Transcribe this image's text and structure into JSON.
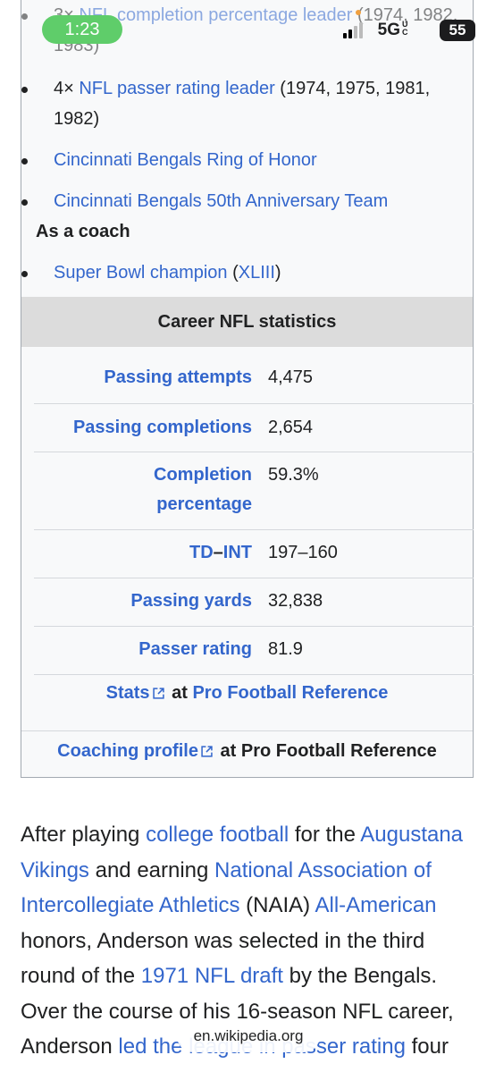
{
  "status_bar": {
    "time": "1:23",
    "network": "5G",
    "network_sub": "UC",
    "battery": "55"
  },
  "infobox": {
    "items_top": [
      {
        "prefix": "3× ",
        "link": "NFL completion percentage leader",
        "suffix": " (1974, 1982, 1983)"
      },
      {
        "prefix": "4× ",
        "link": "NFL passer rating leader",
        "suffix": " (1974, 1975, 1981, 1982)"
      },
      {
        "prefix": "",
        "link": "Cincinnati Bengals Ring of Honor",
        "suffix": ""
      },
      {
        "prefix": "",
        "link": "Cincinnati Bengals 50th Anniversary Team",
        "suffix": ""
      }
    ],
    "coach_label": "As a coach",
    "coach_item": {
      "link": "Super Bowl champion",
      "paren_open": " (",
      "link2": "XLIII",
      "paren_close": ")"
    },
    "stats_header": "Career NFL statistics",
    "stats": [
      {
        "label": "Passing attempts",
        "value": "4,475"
      },
      {
        "label": "Passing completions",
        "value": "2,654"
      },
      {
        "label": "Completion percentage",
        "label_line1": "Completion",
        "label_line2": "percentage",
        "value": "59.3%"
      },
      {
        "label_a": "TD",
        "label_sep": "–",
        "label_b": "INT",
        "value": "197–160"
      },
      {
        "label": "Passing yards",
        "value": "32,838"
      },
      {
        "label": "Passer rating",
        "value": "81.9"
      }
    ],
    "stats_link": {
      "link": "Stats",
      "at": " at ",
      "source": "Pro Football Reference"
    },
    "coaching_link": {
      "link": "Coaching profile",
      "at": " at Pro Football Reference"
    }
  },
  "article": {
    "t1": "After playing ",
    "l1": "college football",
    "t2": " for the ",
    "l2": "Augustana Vikings",
    "t3": " and earning ",
    "l3": "National Association of Intercollegiate Athletics",
    "t4": " (NAIA) ",
    "l4": "All-American",
    "t5": " honors, Anderson was selected in the third round of the ",
    "l5": "1971 NFL draft",
    "t6": " by the Bengals. Over the course of his 16-season NFL career, Anderson ",
    "l6": "led the league in passer rating",
    "t7": " four"
  },
  "browser": {
    "url": "en.wikipedia.org"
  },
  "colors": {
    "link": "#3366cc",
    "pill": "#5fcd6a",
    "header_bg": "#dcdcdc"
  }
}
